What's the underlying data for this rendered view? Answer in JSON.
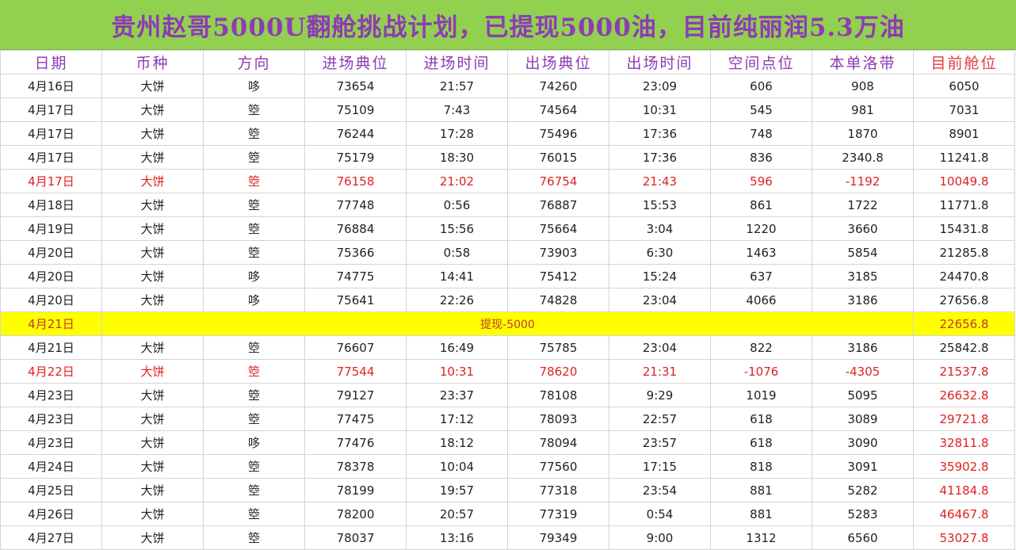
{
  "title": "贵州赵哥5000U翻舱挑战计划，已提现5000油，目前纯丽润5.3万油",
  "columns": [
    "日期",
    "币种",
    "方向",
    "进场典位",
    "进场时间",
    "出场典位",
    "出场时间",
    "空间点位",
    "本单洛带",
    "目前舱位"
  ],
  "colors": {
    "banner_bg": "#92d050",
    "header_text": "#8e3bb5",
    "loss_text": "#e02020",
    "withdraw_bg": "#ffff00"
  },
  "rows": [
    {
      "type": "trade",
      "date": "4月16日",
      "coin": "大饼",
      "dir": "哆",
      "entry": "73654",
      "etime": "21:57",
      "exit": "74260",
      "xtime": "23:09",
      "space": "606",
      "pnl": "908",
      "pos": "6050"
    },
    {
      "type": "trade",
      "date": "4月17日",
      "coin": "大饼",
      "dir": "箜",
      "entry": "75109",
      "etime": "7:43",
      "exit": "74564",
      "xtime": "10:31",
      "space": "545",
      "pnl": "981",
      "pos": "7031"
    },
    {
      "type": "trade",
      "date": "4月17日",
      "coin": "大饼",
      "dir": "箜",
      "entry": "76244",
      "etime": "17:28",
      "exit": "75496",
      "xtime": "17:36",
      "space": "748",
      "pnl": "1870",
      "pos": "8901"
    },
    {
      "type": "trade",
      "date": "4月17日",
      "coin": "大饼",
      "dir": "箜",
      "entry": "75179",
      "etime": "18:30",
      "exit": "76015",
      "xtime": "17:36",
      "space": "836",
      "pnl": "2340.8",
      "pos": "11241.8"
    },
    {
      "type": "loss",
      "date": "4月17日",
      "coin": "大饼",
      "dir": "箜",
      "entry": "76158",
      "etime": "21:02",
      "exit": "76754",
      "xtime": "21:43",
      "space": "596",
      "pnl": "-1192",
      "pos": "10049.8"
    },
    {
      "type": "trade",
      "date": "4月18日",
      "coin": "大饼",
      "dir": "箜",
      "entry": "77748",
      "etime": "0:56",
      "exit": "76887",
      "xtime": "15:53",
      "space": "861",
      "pnl": "1722",
      "pos": "11771.8"
    },
    {
      "type": "trade",
      "date": "4月19日",
      "coin": "大饼",
      "dir": "箜",
      "entry": "76884",
      "etime": "15:56",
      "exit": "75664",
      "xtime": "3:04",
      "space": "1220",
      "pnl": "3660",
      "pos": "15431.8"
    },
    {
      "type": "trade",
      "date": "4月20日",
      "coin": "大饼",
      "dir": "箜",
      "entry": "75366",
      "etime": "0:58",
      "exit": "73903",
      "xtime": "6:30",
      "space": "1463",
      "pnl": "5854",
      "pos": "21285.8"
    },
    {
      "type": "trade",
      "date": "4月20日",
      "coin": "大饼",
      "dir": "哆",
      "entry": "74775",
      "etime": "14:41",
      "exit": "75412",
      "xtime": "15:24",
      "space": "637",
      "pnl": "3185",
      "pos": "24470.8"
    },
    {
      "type": "trade",
      "date": "4月20日",
      "coin": "大饼",
      "dir": "哆",
      "entry": "75641",
      "etime": "22:26",
      "exit": "74828",
      "xtime": "23:04",
      "space": "4066",
      "pnl": "3186",
      "pos": "27656.8"
    },
    {
      "type": "withdraw",
      "date": "4月21日",
      "note": "提现-5000",
      "pos": "22656.8"
    },
    {
      "type": "trade",
      "date": "4月21日",
      "coin": "大饼",
      "dir": "箜",
      "entry": "76607",
      "etime": "16:49",
      "exit": "75785",
      "xtime": "23:04",
      "space": "822",
      "pnl": "3186",
      "pos": "25842.8"
    },
    {
      "type": "loss",
      "date": "4月22日",
      "coin": "大饼",
      "dir": "箜",
      "entry": "77544",
      "etime": "10:31",
      "exit": "78620",
      "xtime": "21:31",
      "space": "-1076",
      "pnl": "-4305",
      "pos": "21537.8"
    },
    {
      "type": "trade",
      "posred": true,
      "date": "4月23日",
      "coin": "大饼",
      "dir": "箜",
      "entry": "79127",
      "etime": "23:37",
      "exit": "78108",
      "xtime": "9:29",
      "space": "1019",
      "pnl": "5095",
      "pos": "26632.8"
    },
    {
      "type": "trade",
      "posred": true,
      "date": "4月23日",
      "coin": "大饼",
      "dir": "箜",
      "entry": "77475",
      "etime": "17:12",
      "exit": "78093",
      "xtime": "22:57",
      "space": "618",
      "pnl": "3089",
      "pos": "29721.8"
    },
    {
      "type": "trade",
      "posred": true,
      "date": "4月23日",
      "coin": "大饼",
      "dir": "哆",
      "entry": "77476",
      "etime": "18:12",
      "exit": "78094",
      "xtime": "23:57",
      "space": "618",
      "pnl": "3090",
      "pos": "32811.8"
    },
    {
      "type": "trade",
      "posred": true,
      "date": "4月24日",
      "coin": "大饼",
      "dir": "箜",
      "entry": "78378",
      "etime": "10:04",
      "exit": "77560",
      "xtime": "17:15",
      "space": "818",
      "pnl": "3091",
      "pos": "35902.8"
    },
    {
      "type": "trade",
      "posred": true,
      "date": "4月25日",
      "coin": "大饼",
      "dir": "箜",
      "entry": "78199",
      "etime": "19:57",
      "exit": "77318",
      "xtime": "23:54",
      "space": "881",
      "pnl": "5282",
      "pos": "41184.8"
    },
    {
      "type": "trade",
      "posred": true,
      "date": "4月26日",
      "coin": "大饼",
      "dir": "箜",
      "entry": "78200",
      "etime": "20:57",
      "exit": "77319",
      "xtime": "0:54",
      "space": "881",
      "pnl": "5283",
      "pos": "46467.8"
    },
    {
      "type": "trade",
      "posred": true,
      "date": "4月27日",
      "coin": "大饼",
      "dir": "箜",
      "entry": "78037",
      "etime": "13:16",
      "exit": "79349",
      "xtime": "9:00",
      "space": "1312",
      "pnl": "6560",
      "pos": "53027.8"
    }
  ]
}
